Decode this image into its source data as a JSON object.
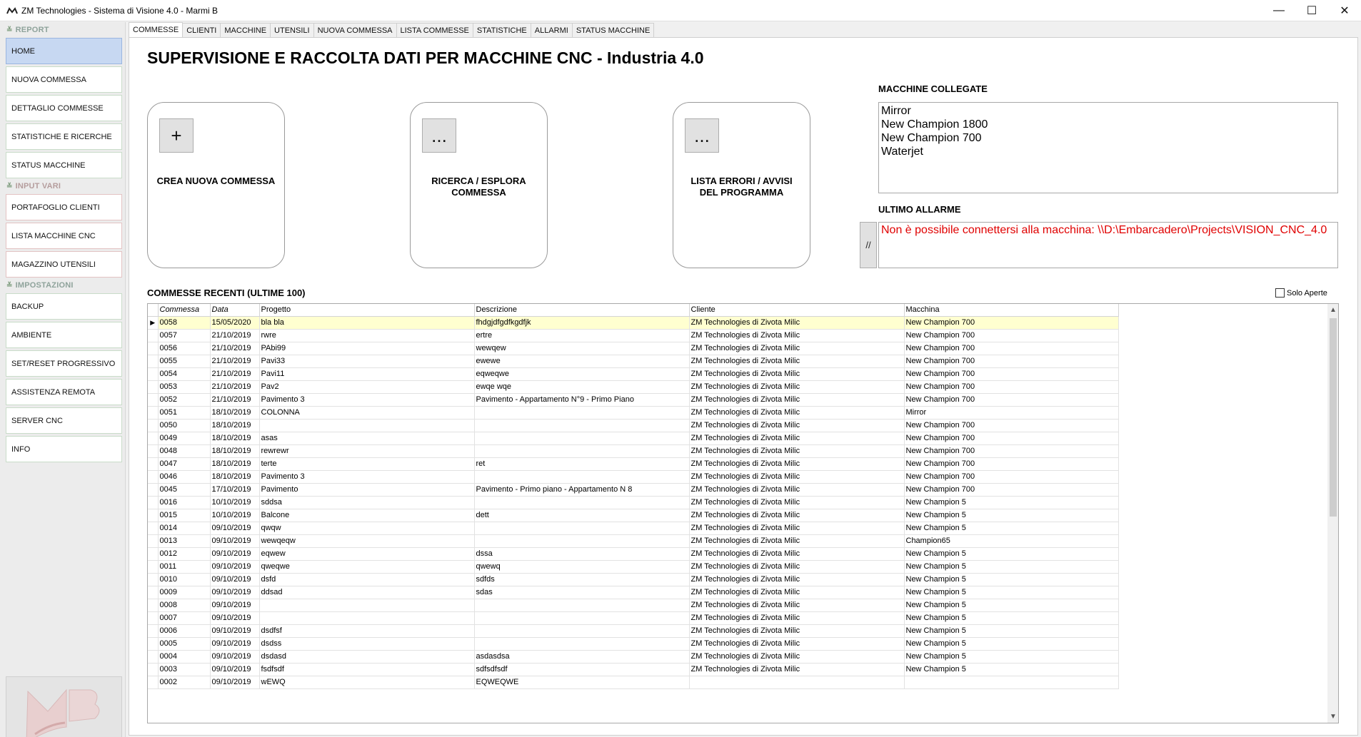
{
  "window": {
    "title": "ZM Technologies - Sistema di Visione 4.0 - Marmi B",
    "minimize": "—",
    "maximize": "☐",
    "close": "✕"
  },
  "sidebar": {
    "report_header": "REPORT",
    "input_header": "INPUT VARI",
    "imp_header": "IMPOSTAZIONI",
    "report_items": [
      "HOME",
      "NUOVA COMMESSA",
      "DETTAGLIO COMMESSE",
      "STATISTICHE E RICERCHE",
      "STATUS MACCHINE"
    ],
    "input_items": [
      "PORTAFOGLIO CLIENTI",
      "LISTA MACCHINE CNC",
      "MAGAZZINO UTENSILI"
    ],
    "imp_items": [
      "BACKUP",
      "AMBIENTE",
      "SET/RESET PROGRESSIVO",
      "ASSISTENZA REMOTA",
      "SERVER CNC",
      "INFO"
    ]
  },
  "tabs": [
    "COMMESSE",
    "CLIENTI",
    "MACCHINE",
    "UTENSILI",
    "NUOVA COMMESSA",
    "LISTA COMMESSE",
    "STATISTICHE",
    "ALLARMI",
    "STATUS MACCHINE"
  ],
  "main": {
    "title": "SUPERVISIONE E RACCOLTA DATI PER MACCHINE CNC - Industria 4.0",
    "cards": [
      {
        "icon": "+",
        "label_line1": "CREA NUOVA COMMESSA",
        "label_line2": ""
      },
      {
        "icon": "...",
        "label_line1": "RICERCA / ESPLORA",
        "label_line2": "COMMESSA"
      },
      {
        "icon": "...",
        "label_line1": "LISTA ERRORI / AVVISI",
        "label_line2": "DEL PROGRAMMA"
      }
    ],
    "machines_label": "MACCHINE COLLEGATE",
    "machines": [
      "Mirror",
      "New Champion 1800",
      "New Champion 700",
      "Waterjet"
    ],
    "alarm_label": "ULTIMO ALLARME",
    "alarm_button": "//",
    "alarm_text": "Non è possibile connettersi alla macchina: \\\\D:\\Embarcadero\\Projects\\VISION_CNC_4.0",
    "recent_label": "COMMESSE RECENTI (ULTIME 100)",
    "solo_aperte": "Solo Aperte"
  },
  "grid": {
    "columns": [
      "Commessa",
      "Data",
      "Progetto",
      "Descrizione",
      "Cliente",
      "Macchina"
    ],
    "selected_marker": "▶",
    "rows": [
      [
        "0058",
        "15/05/2020",
        "bla bla",
        "fhdgjdfgdfkgdfjk",
        "ZM Technologies di Zivota Milic",
        "New Champion 700"
      ],
      [
        "0057",
        "21/10/2019",
        "rwre",
        "ertre",
        "ZM Technologies di Zivota Milic",
        "New Champion 700"
      ],
      [
        "0056",
        "21/10/2019",
        "PAbi99",
        "wewqew",
        "ZM Technologies di Zivota Milic",
        "New Champion 700"
      ],
      [
        "0055",
        "21/10/2019",
        "Pavi33",
        "ewewe",
        "ZM Technologies di Zivota Milic",
        "New Champion 700"
      ],
      [
        "0054",
        "21/10/2019",
        "Pavi11",
        "eqweqwe",
        "ZM Technologies di Zivota Milic",
        "New Champion 700"
      ],
      [
        "0053",
        "21/10/2019",
        "Pav2",
        "ewqe wqe",
        "ZM Technologies di Zivota Milic",
        "New Champion 700"
      ],
      [
        "0052",
        "21/10/2019",
        "Pavimento 3",
        "Pavimento - Appartamento N°9 - Primo Piano",
        "ZM Technologies di Zivota Milic",
        "New Champion 700"
      ],
      [
        "0051",
        "18/10/2019",
        "COLONNA",
        "",
        "ZM Technologies di Zivota Milic",
        "Mirror"
      ],
      [
        "0050",
        "18/10/2019",
        "",
        "",
        "ZM Technologies di Zivota Milic",
        "New Champion 700"
      ],
      [
        "0049",
        "18/10/2019",
        "asas",
        "",
        "ZM Technologies di Zivota Milic",
        "New Champion 700"
      ],
      [
        "0048",
        "18/10/2019",
        "rewrewr",
        "",
        "ZM Technologies di Zivota Milic",
        "New Champion 700"
      ],
      [
        "0047",
        "18/10/2019",
        "terte",
        "ret",
        "ZM Technologies di Zivota Milic",
        "New Champion 700"
      ],
      [
        "0046",
        "18/10/2019",
        "Pavimento 3",
        "",
        "ZM Technologies di Zivota Milic",
        "New Champion 700"
      ],
      [
        "0045",
        "17/10/2019",
        "Pavimento",
        "Pavimento - Primo piano - Appartamento N 8",
        "ZM Technologies di Zivota Milic",
        "New Champion 700"
      ],
      [
        "0016",
        "10/10/2019",
        "sddsa",
        "",
        "ZM Technologies di Zivota Milic",
        "New Champion 5"
      ],
      [
        "0015",
        "10/10/2019",
        "Balcone",
        "dett",
        "ZM Technologies di Zivota Milic",
        "New Champion 5"
      ],
      [
        "0014",
        "09/10/2019",
        "qwqw",
        "",
        "ZM Technologies di Zivota Milic",
        "New Champion 5"
      ],
      [
        "0013",
        "09/10/2019",
        "wewqeqw",
        "",
        "ZM Technologies di Zivota Milic",
        "Champion65"
      ],
      [
        "0012",
        "09/10/2019",
        "eqwew",
        "dssa",
        "ZM Technologies di Zivota Milic",
        "New Champion 5"
      ],
      [
        "0011",
        "09/10/2019",
        "qweqwe",
        "qwewq",
        "ZM Technologies di Zivota Milic",
        "New Champion 5"
      ],
      [
        "0010",
        "09/10/2019",
        "dsfd",
        "sdfds",
        "ZM Technologies di Zivota Milic",
        "New Champion 5"
      ],
      [
        "0009",
        "09/10/2019",
        "ddsad",
        "sdas",
        "ZM Technologies di Zivota Milic",
        "New Champion 5"
      ],
      [
        "0008",
        "09/10/2019",
        "",
        "",
        "ZM Technologies di Zivota Milic",
        "New Champion 5"
      ],
      [
        "0007",
        "09/10/2019",
        "",
        "",
        "ZM Technologies di Zivota Milic",
        "New Champion 5"
      ],
      [
        "0006",
        "09/10/2019",
        "dsdfsf",
        "",
        "ZM Technologies di Zivota Milic",
        "New Champion 5"
      ],
      [
        "0005",
        "09/10/2019",
        "dsdss",
        "",
        "ZM Technologies di Zivota Milic",
        "New Champion 5"
      ],
      [
        "0004",
        "09/10/2019",
        "dsdasd",
        "asdasdsa",
        "ZM Technologies di Zivota Milic",
        "New Champion 5"
      ],
      [
        "0003",
        "09/10/2019",
        "fsdfsdf",
        "sdfsdfsdf",
        "ZM Technologies di Zivota Milic",
        "New Champion 5"
      ],
      [
        "0002",
        "09/10/2019",
        "wEWQ",
        "EQWEQWE",
        "",
        ""
      ]
    ]
  },
  "colors": {
    "alarm_text": "#e00000",
    "selected_row": "#ffffd0",
    "active_sidebar": "#c7d8f2"
  }
}
